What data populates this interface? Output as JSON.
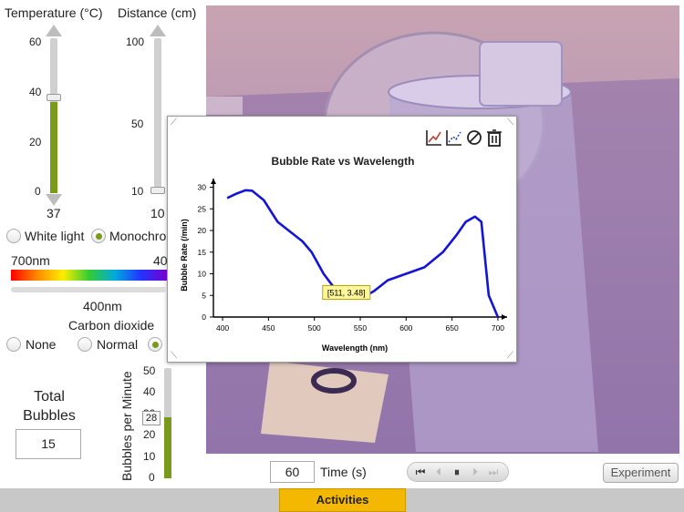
{
  "temperature": {
    "label": "Temperature (°C)",
    "ticks": [
      "60",
      "40",
      "20",
      "0"
    ],
    "value": "37",
    "level_fraction": 0.62
  },
  "distance": {
    "label": "Distance (cm)",
    "ticks": [
      "100",
      "50",
      "10"
    ],
    "value": "10",
    "level_fraction": 0.0
  },
  "light": {
    "white": "White light",
    "mono": "Monochro",
    "selected": "mono"
  },
  "wavelength": {
    "left": "700nm",
    "right": "40",
    "value": "400nm"
  },
  "co2": {
    "title": "Carbon dioxide",
    "none": "None",
    "normal": "Normal",
    "selected": "high"
  },
  "total": {
    "title_1": "Total",
    "title_2": "Bubbles",
    "value": "15"
  },
  "bpm": {
    "label": "Bubbles per Minute",
    "ticks": [
      "50",
      "40",
      "30",
      "20",
      "10",
      "0"
    ],
    "value": "28",
    "level_fraction": 0.56
  },
  "time": {
    "value": "60",
    "label": "Time (s)"
  },
  "buttons": {
    "experiment": "Experiment",
    "activities": "Activities"
  },
  "graph_icons": [
    "line-chart-icon",
    "scatter-chart-icon",
    "clear-icon",
    "trash-icon"
  ],
  "colors": {
    "accent": "#7a9a1a",
    "activities_tab": "#f5b800",
    "curve": "#1414d8",
    "tooltip": "#fff79a"
  },
  "chart_data": {
    "type": "line",
    "title": "Bubble Rate vs Wavelength",
    "xlabel": "Wavelength (nm)",
    "ylabel": "Bubble Rate (/min)",
    "xlim": [
      390,
      710
    ],
    "ylim": [
      0,
      32
    ],
    "xticks": [
      "400",
      "450",
      "500",
      "550",
      "600",
      "650",
      "700"
    ],
    "yticks": [
      "0",
      "5",
      "10",
      "15",
      "20",
      "25",
      "30"
    ],
    "grid": false,
    "tooltip": "[511, 3.48]",
    "tooltip_point": [
      511,
      3.48
    ],
    "series": [
      {
        "x": [
          405,
          415,
          425,
          432,
          445,
          460,
          475,
          487,
          497,
          510,
          520,
          530,
          545,
          555,
          565,
          580,
          600,
          620,
          640,
          655,
          665,
          675,
          682,
          690,
          700
        ],
        "y": [
          27.5,
          28.5,
          29.3,
          29.2,
          27,
          22,
          19.5,
          17.5,
          15,
          10,
          7.2,
          6.2,
          5,
          4.8,
          6,
          8.5,
          10,
          11.5,
          15,
          19,
          22,
          23.2,
          22,
          5,
          0
        ]
      }
    ]
  }
}
